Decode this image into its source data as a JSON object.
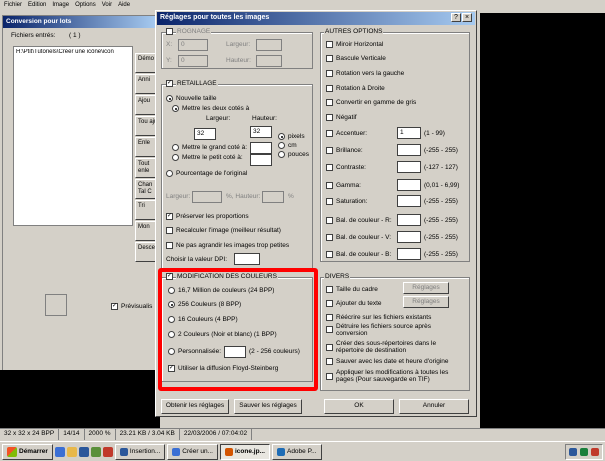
{
  "bg_app": {
    "menu": [
      "Fichier",
      "Edition",
      "Image",
      "Options",
      "Voir",
      "Aide"
    ],
    "dialog_title": "Conversion pour lots",
    "files_label": "Fichiers entrés:",
    "files_count": "( 1 )",
    "file_path": "H:\\Ptit\\Tutoriels\\Créer une icône\\icon",
    "buttons": [
      "Démo",
      "Anni",
      "Ajou",
      "Tou aju",
      "Enle",
      "Tout enle",
      "Chan Tal C",
      "Tri",
      "Mon",
      "Desce"
    ],
    "preview_label": "Prévisualis"
  },
  "dialog": {
    "title": "Réglages pour toutes les images",
    "help_btn": "?",
    "close_btn": "×",
    "crop": {
      "label": "ROGNAGE",
      "x_label": "X:",
      "x_value": "0",
      "y_label": "Y:",
      "y_value": "0",
      "width_label": "Largeur:",
      "height_label": "Hauteur:"
    },
    "resize": {
      "label": "RETAILLAGE",
      "new_size": "Nouvelle taille",
      "both_sides": "Mettre les deux cotés à",
      "width_label": "Largeur:",
      "height_label": "Hauteur:",
      "width_value": "32",
      "height_value": "32",
      "units": [
        "pixels",
        "cm",
        "pouces"
      ],
      "longest_side": "Mettre le grand coté à:",
      "shortest_side": "Mettre le petit coté à:",
      "percent": "Pourcentage de l'original",
      "pct_width_label": "Largeur:",
      "pct_height_label": "%, Hauteur:",
      "pct_suffix": "%",
      "keep_ratio": "Préserver les proportions",
      "resample": "Recalculer l'image (meilleur résultat)",
      "no_enlarge": "Ne pas agrandir les images trop petites",
      "dpi": "Choisir la valeur DPI:"
    },
    "colors": {
      "label": "MODIFICATION DES COULEURS",
      "options": [
        "16,7 Million de couleurs (24 BPP)",
        "256 Couleurs (8 BPP)",
        "16 Couleurs (4 BPP)",
        "2 Couleurs (Noir et blanc) (1 BPP)",
        "Personnalisée:"
      ],
      "custom_range": "(2 - 256 couleurs)",
      "dither": "Utiliser la diffusion Floyd-Steinberg"
    },
    "other": {
      "label": "AUTRES OPTIONS",
      "items": [
        "Miroir Horizontal",
        "Bascule Verticale",
        "Rotation vers la gauche",
        "Rotation à Droite",
        "Convertir en gamme de gris",
        "Négatif"
      ],
      "adjustments": [
        {
          "label": "Accentuer:",
          "value": "1",
          "range": "(1 - 99)"
        },
        {
          "label": "Brillance:",
          "value": "",
          "range": "(-255 - 255)"
        },
        {
          "label": "Contraste:",
          "value": "",
          "range": "(-127 - 127)"
        },
        {
          "label": "Gamma:",
          "value": "",
          "range": "(0,01 - 6,99)"
        },
        {
          "label": "Saturation:",
          "value": "",
          "range": "(-255 - 255)"
        },
        {
          "label": "Bal. de couleur - R:",
          "value": "",
          "range": "(-255 - 255)"
        },
        {
          "label": "Bal. de couleur - V:",
          "value": "",
          "range": "(-255 - 255)"
        },
        {
          "label": "Bal. de couleur - B:",
          "value": "",
          "range": "(-255 - 255)"
        }
      ]
    },
    "misc": {
      "label": "DIVERS",
      "canvas_size": "Taille du cadre",
      "add_text": "Ajouter du texte",
      "settings_btn": "Réglages",
      "items": [
        "Réécrire sur les fichiers existants",
        "Détruire les fichiers source après conversion",
        "Créer des sous-répertoires dans le répertoire de destination",
        "Sauver avec les date et heure d'origine",
        "Appliquer les modifications à toutes les pages (Pour sauvegarde en TIF)"
      ]
    },
    "buttons": {
      "get": "Obtenir les réglages",
      "save": "Sauver les réglages",
      "ok": "OK",
      "cancel": "Annuler"
    }
  },
  "statusbar": [
    "32 x 32 x 24 BPP",
    "14/14",
    "2000 %",
    "23.21 KB / 3.04 KB",
    "22/03/2006 / 07:04:02"
  ],
  "taskbar": {
    "start": "Démarrer",
    "tasks": [
      "Insertion...",
      "Créer un...",
      "icone.jp...",
      "Adobe P..."
    ],
    "active_task": "icone.jp...",
    "tray_items": [
      "FR"
    ]
  },
  "colors": {
    "highlight_border": "#ff0000",
    "title_start": "#0a246a",
    "title_end": "#a6caf0",
    "face": "#d4d0c8"
  }
}
